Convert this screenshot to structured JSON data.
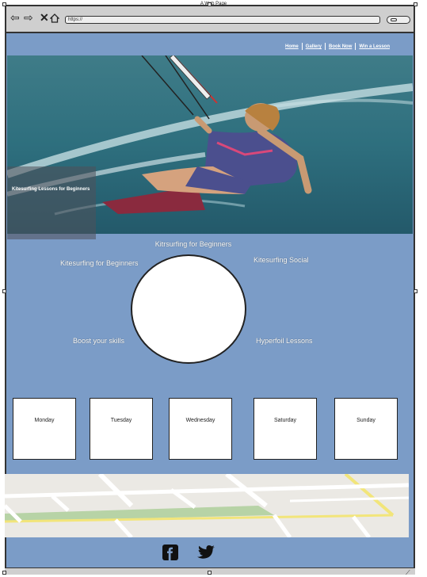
{
  "window": {
    "title": "A Web Page",
    "url": "https://"
  },
  "nav": {
    "items": [
      "Home",
      "Gallery",
      "Book Now",
      "Win a Lesson"
    ]
  },
  "hero": {
    "caption": "Kitesurfing Lessons for Beginners"
  },
  "section": {
    "heading": "Kitrsurfing for Beginners",
    "labels": {
      "top_left": "Kitesurfing for Beginners",
      "top_right": "Kitesurfing Social",
      "bottom_left": "Boost your skills",
      "bottom_right": "Hyperfoil Lessons"
    }
  },
  "schedule": {
    "days": [
      "Monday",
      "Tuesday",
      "Wednesday",
      "Saturday",
      "Sunday"
    ]
  },
  "footer": {
    "icons": [
      "facebook-icon",
      "twitter-icon"
    ]
  },
  "colors": {
    "page_bg": "#7b9cc7",
    "chrome": "#cfcfcf"
  }
}
